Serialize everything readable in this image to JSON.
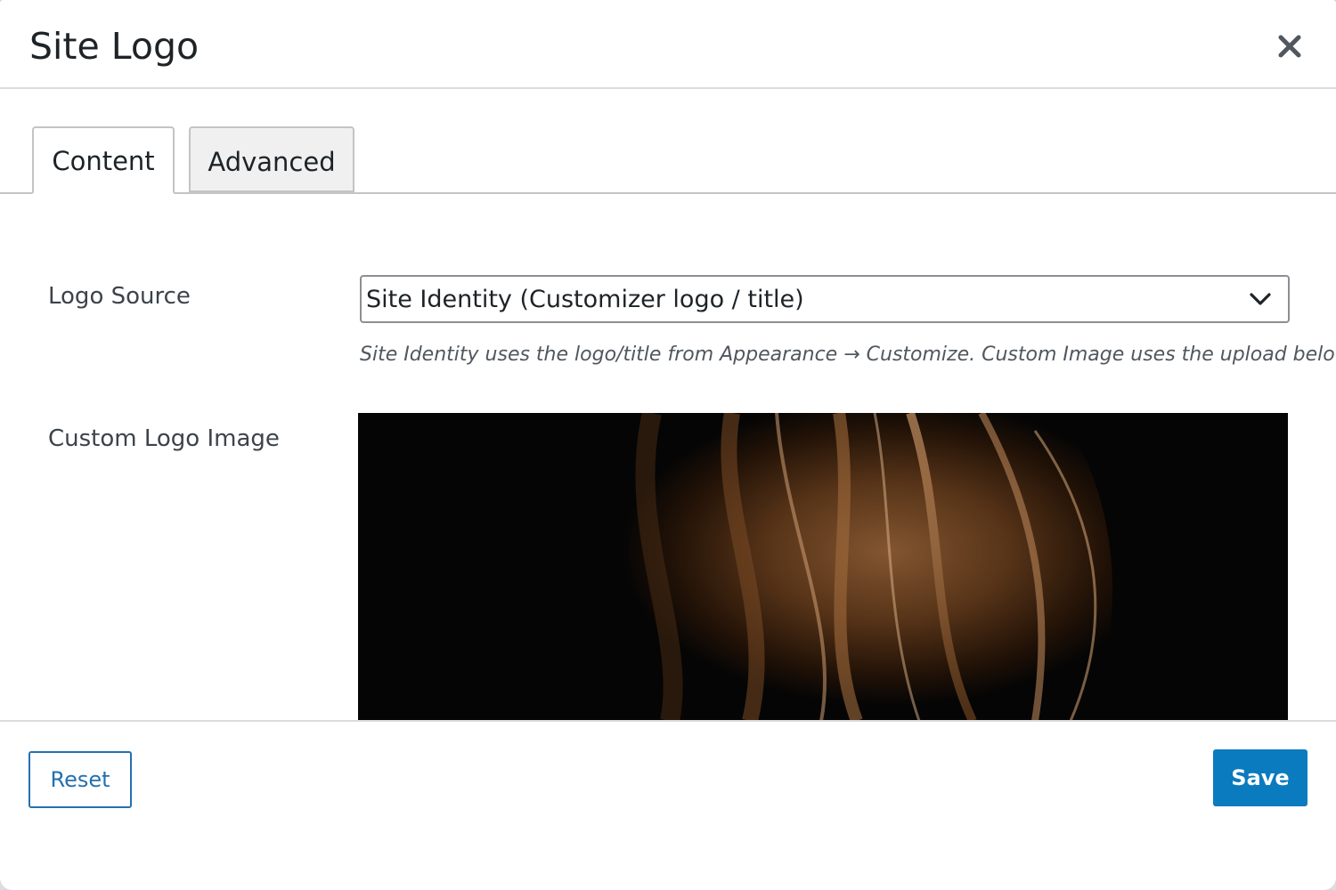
{
  "modal": {
    "title": "Site Logo",
    "close_icon": "close-icon"
  },
  "tabs": [
    {
      "label": "Content",
      "active": true
    },
    {
      "label": "Advanced",
      "active": false
    }
  ],
  "fields": {
    "logo_source": {
      "label": "Logo Source",
      "selected": "Site Identity (Customizer logo / title)",
      "icon": "chevron-down-icon",
      "help": "Site Identity uses the logo/title from Appearance → Customize. Custom Image uses the upload below."
    },
    "custom_logo_image": {
      "label": "Custom Logo Image"
    }
  },
  "footer": {
    "reset_label": "Reset",
    "save_label": "Save"
  },
  "colors": {
    "accent": "#2271b1",
    "primary_button": "#0a7bbf"
  }
}
